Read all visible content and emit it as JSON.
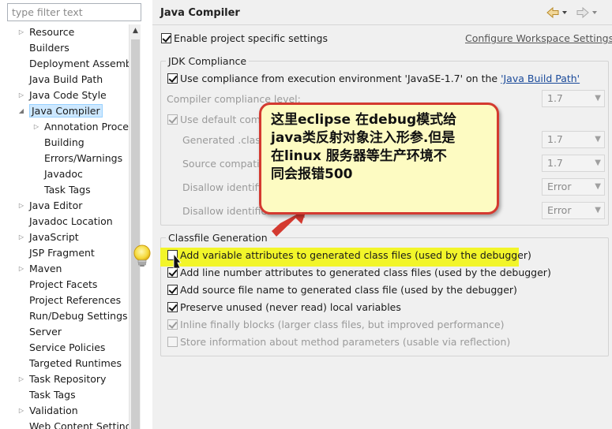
{
  "filter": {
    "placeholder": "type filter text"
  },
  "tree": {
    "items": [
      {
        "label": "Resource",
        "expandable": true,
        "level": 0
      },
      {
        "label": "Builders",
        "expandable": false,
        "level": 0
      },
      {
        "label": "Deployment Assembly",
        "expandable": false,
        "level": 0
      },
      {
        "label": "Java Build Path",
        "expandable": false,
        "level": 0
      },
      {
        "label": "Java Code Style",
        "expandable": true,
        "level": 0
      },
      {
        "label": "Java Compiler",
        "expandable": true,
        "expanded": true,
        "selected": true,
        "level": 0
      },
      {
        "label": "Annotation Processing",
        "expandable": true,
        "level": 1
      },
      {
        "label": "Building",
        "expandable": false,
        "level": 1
      },
      {
        "label": "Errors/Warnings",
        "expandable": false,
        "level": 1
      },
      {
        "label": "Javadoc",
        "expandable": false,
        "level": 1
      },
      {
        "label": "Task Tags",
        "expandable": false,
        "level": 1
      },
      {
        "label": "Java Editor",
        "expandable": true,
        "level": 0
      },
      {
        "label": "Javadoc Location",
        "expandable": false,
        "level": 0
      },
      {
        "label": "JavaScript",
        "expandable": true,
        "level": 0
      },
      {
        "label": "JSP Fragment",
        "expandable": false,
        "level": 0
      },
      {
        "label": "Maven",
        "expandable": true,
        "level": 0
      },
      {
        "label": "Project Facets",
        "expandable": false,
        "level": 0
      },
      {
        "label": "Project References",
        "expandable": false,
        "level": 0
      },
      {
        "label": "Run/Debug Settings",
        "expandable": false,
        "level": 0
      },
      {
        "label": "Server",
        "expandable": false,
        "level": 0
      },
      {
        "label": "Service Policies",
        "expandable": false,
        "level": 0
      },
      {
        "label": "Targeted Runtimes",
        "expandable": false,
        "level": 0
      },
      {
        "label": "Task Repository",
        "expandable": true,
        "level": 0
      },
      {
        "label": "Task Tags",
        "expandable": false,
        "level": 0
      },
      {
        "label": "Validation",
        "expandable": true,
        "level": 0
      },
      {
        "label": "Web Content Settings",
        "expandable": false,
        "level": 0
      }
    ]
  },
  "page": {
    "title": "Java Compiler",
    "enable_specific": {
      "label": "Enable project specific settings",
      "checked": true
    },
    "configure_link": "Configure Workspace Settings..."
  },
  "jdk": {
    "legend": "JDK Compliance",
    "use_compliance": {
      "prefix": "Use compliance from execution environment 'JavaSE-1.7' on the ",
      "link": "'Java Build Path'",
      "checked": true
    },
    "compliance_level": {
      "label": "Compiler compliance level:",
      "value": "1.7"
    },
    "use_default": {
      "label": "Use default compliance settings",
      "checked": true
    },
    "generated_class": {
      "label": "Generated .class files compatibility:",
      "value": "1.7"
    },
    "source_compat": {
      "label": "Source compatibility:",
      "value": "1.7"
    },
    "disallow_assert": {
      "label": "Disallow identifiers called 'assert':",
      "value": "Error"
    },
    "disallow_enum": {
      "label": "Disallow identifiers called 'enum':",
      "value": "Error"
    }
  },
  "classfile": {
    "legend": "Classfile Generation",
    "options": [
      {
        "label": "Add variable attributes to generated class files (used by the debugger)",
        "checked": false,
        "enabled": true
      },
      {
        "label": "Add line number attributes to generated class files (used by the debugger)",
        "checked": true,
        "enabled": true
      },
      {
        "label": "Add source file name to generated class file (used by the debugger)",
        "checked": true,
        "enabled": true
      },
      {
        "label": "Preserve unused (never read) local variables",
        "checked": true,
        "enabled": true
      },
      {
        "label": "Inline finally blocks (larger class files, but improved performance)",
        "checked": true,
        "enabled": false
      },
      {
        "label": "Store information about method parameters (usable via reflection)",
        "checked": false,
        "enabled": false
      }
    ]
  },
  "callout": {
    "lines": [
      "这里eclipse 在debug模式给",
      "java类反射对象注入形参.但是",
      "在linux 服务器等生产环境不",
      "同会报错500"
    ],
    "border_color": "#d43a30",
    "background_color": "#fdfbc2"
  },
  "colors": {
    "highlight": "#f2f52a",
    "selection": "#cde8ff",
    "link": "#1a4a9a"
  }
}
